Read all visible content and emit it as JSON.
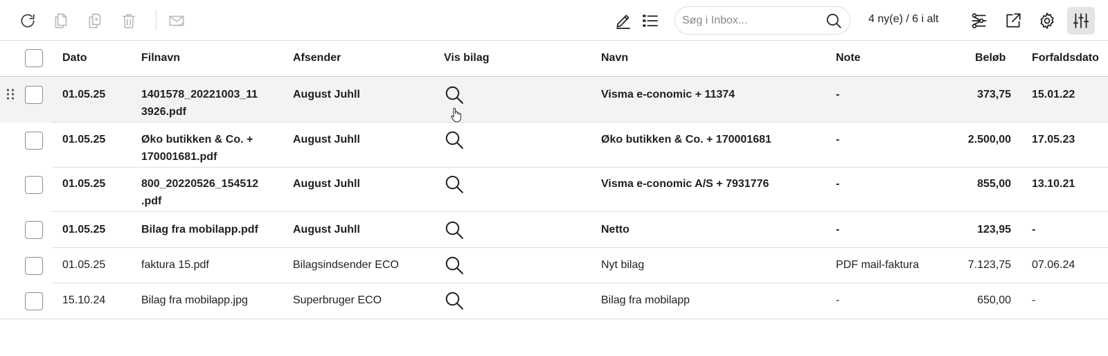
{
  "toolbar": {
    "icons": {
      "refresh": "refresh-icon",
      "copy": "copy-icon",
      "duplicate": "duplicate-icon",
      "delete": "trash-icon",
      "mark_read": "mail-check-icon",
      "edit": "pencil-icon",
      "list": "list-icon",
      "filter": "filter-icon",
      "open_external": "external-link-icon",
      "settings": "gear-icon",
      "columns": "sliders-icon"
    },
    "search_placeholder": "Søg i Inbox...",
    "count_label": "4 ny(e) / 6 i alt"
  },
  "table": {
    "headers": {
      "dato": "Dato",
      "filnavn": "Filnavn",
      "afsender": "Afsender",
      "vis_bilag": "Vis bilag",
      "navn": "Navn",
      "note": "Note",
      "belob": "Beløb",
      "forfaldsdato": "Forfaldsdato"
    },
    "rows": [
      {
        "dato": "01.05.25",
        "filnavn_1": "1401578_20221003_11",
        "filnavn_2": "3926.pdf",
        "afsender": "August Juhll",
        "navn": "Visma e-conomic + 11374",
        "note": "-",
        "belob": "373,75",
        "forfaldsdato": "15.01.22"
      },
      {
        "dato": "01.05.25",
        "filnavn_1": "Øko butikken & Co. +",
        "filnavn_2": "170001681.pdf",
        "afsender": "August Juhll",
        "navn": "Øko butikken & Co. + 170001681",
        "note": "-",
        "belob": "2.500,00",
        "forfaldsdato": "17.05.23"
      },
      {
        "dato": "01.05.25",
        "filnavn_1": "800_20220526_154512",
        "filnavn_2": ".pdf",
        "afsender": "August Juhll",
        "navn": "Visma e-conomic A/S + 7931776",
        "note": "-",
        "belob": "855,00",
        "forfaldsdato": "13.10.21"
      },
      {
        "dato": "01.05.25",
        "filnavn_1": "Bilag fra mobilapp.pdf",
        "filnavn_2": "",
        "afsender": "August Juhll",
        "navn": "Netto",
        "note": "-",
        "belob": "123,95",
        "forfaldsdato": "-"
      },
      {
        "dato": "01.05.25",
        "filnavn_1": "faktura 15.pdf",
        "filnavn_2": "",
        "afsender": "Bilagsindsender ECO",
        "navn": "Nyt bilag",
        "note": "PDF mail-faktura",
        "belob": "7.123,75",
        "forfaldsdato": "07.06.24"
      },
      {
        "dato": "15.10.24",
        "filnavn_1": "Bilag fra mobilapp.jpg",
        "filnavn_2": "",
        "afsender": "Superbruger ECO",
        "navn": "Bilag fra mobilapp",
        "note": "-",
        "belob": "650,00",
        "forfaldsdato": "-"
      }
    ]
  },
  "colors": {
    "icon": "#3a3a3a",
    "border": "#dcdcdc",
    "hover_row": "#f3f3f3",
    "active_button": "#e4e4e4"
  }
}
